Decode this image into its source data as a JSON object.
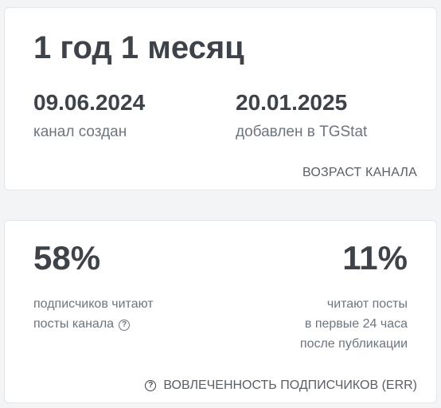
{
  "age_card": {
    "title": "1 год 1 месяц",
    "created_date": "09.06.2024",
    "created_label": "канал создан",
    "added_date": "20.01.2025",
    "added_label": "добавлен в TGStat",
    "footer": "ВОЗРАСТ КАНАЛА"
  },
  "err_card": {
    "left_value": "58%",
    "left_desc_line1": "подписчиков читают",
    "left_desc_line2": "посты канала",
    "right_value": "11%",
    "right_desc_line1": "читают посты",
    "right_desc_line2": "в первые 24 часа",
    "right_desc_line3": "после публикации",
    "footer": "ВОВЛЕЧЕННОСТЬ ПОДПИСЧИКОВ (ERR)",
    "help_icon": "question-circle-icon"
  }
}
